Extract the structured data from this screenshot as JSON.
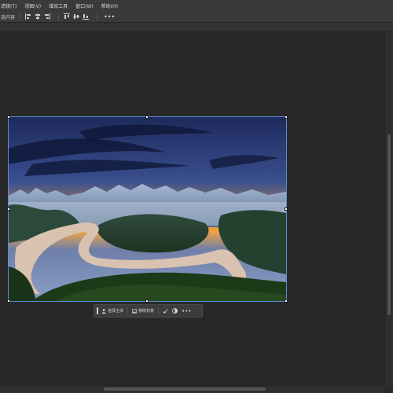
{
  "menu": {
    "items": [
      "滤镜(T)",
      "视图(V)",
      "增效工具",
      "窗口(W)",
      "帮助(H)"
    ]
  },
  "options_bar": {
    "label": "选内容",
    "more_label": "•••",
    "icons": [
      "align-left-icon",
      "align-center-icon",
      "align-right-icon",
      "align-top-icon",
      "align-middle-icon",
      "align-bottom-icon",
      "distribute-left-icon",
      "distribute-center-icon",
      "distribute-right-icon"
    ]
  },
  "contextual_taskbar": {
    "select_subject_label": "选择主体",
    "remove_background_label": "移除背景",
    "more_label": "•••"
  },
  "colors": {
    "app_bg": "#282828",
    "panel_bg": "#3a3a3a",
    "selection_outline": "#5a8fd8"
  }
}
